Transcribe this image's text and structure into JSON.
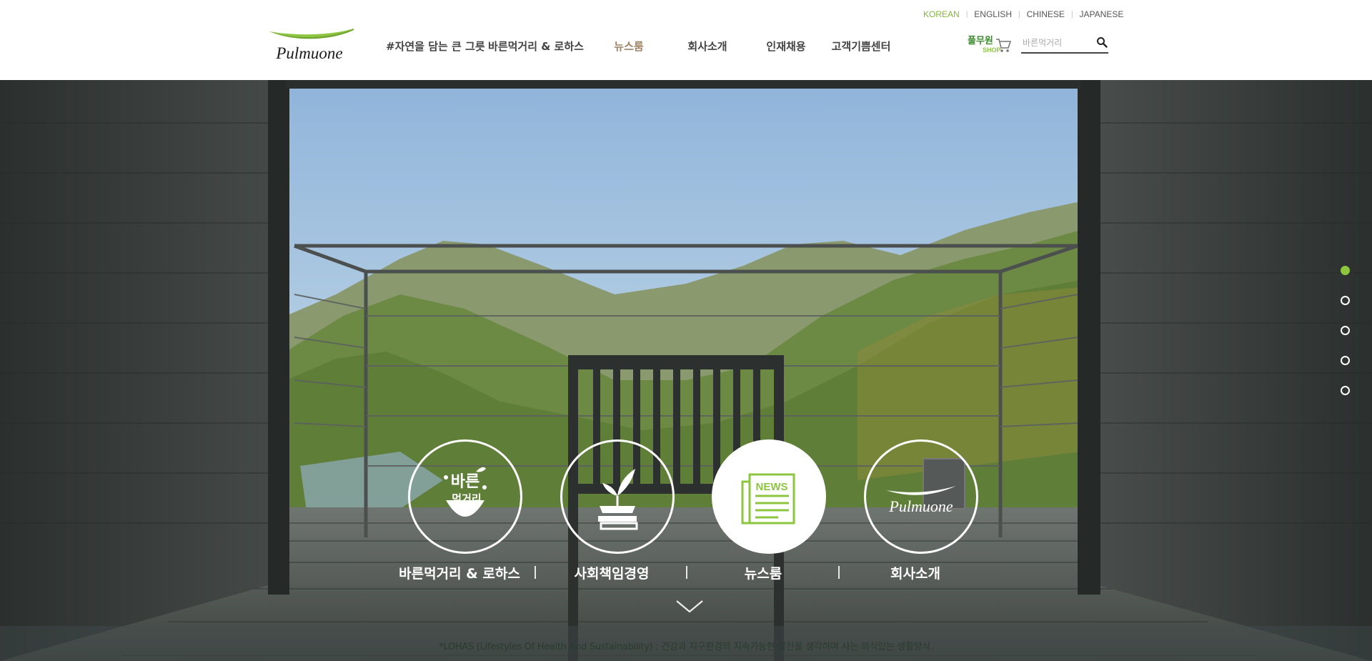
{
  "lang": {
    "items": [
      "KOREAN",
      "ENGLISH",
      "CHINESE",
      "JAPANESE"
    ],
    "active": "KOREAN"
  },
  "logo": {
    "text": "Pulmuone"
  },
  "nav": {
    "items": [
      "#자연을 담는 큰 그릇",
      "바른먹거리 & 로하스",
      "뉴스룸",
      "회사소개",
      "인재채용",
      "고객기쁨센터"
    ],
    "active": "뉴스룸"
  },
  "shop": {
    "label": "풀무원",
    "sub": "SHOP"
  },
  "search": {
    "placeholder": "바른먹거리"
  },
  "colors": {
    "brand_green": "#8cc63f",
    "nav_active": "#a08466"
  },
  "hero": {
    "pager": {
      "count": 5,
      "active_index": 0
    },
    "quick_menu": [
      {
        "label": "바른먹거리 & 로하스",
        "icon": "bareun-mukgeori-icon",
        "icon_text": [
          "바른",
          "먹거리"
        ]
      },
      {
        "label": "사회책임경영",
        "icon": "sprout-books-icon"
      },
      {
        "label": "뉴스룸",
        "icon": "news-icon",
        "icon_text": "NEWS"
      },
      {
        "label": "회사소개",
        "icon": "pulmuone-logo-icon",
        "icon_text": "Pulmuone"
      }
    ],
    "footnote": "*LOHAS (Lifestyles Of Health And Sustainability) : 건강과 지구환경의 지속가능한 발전을 생각하며 사는 의식있는 생활양식."
  }
}
